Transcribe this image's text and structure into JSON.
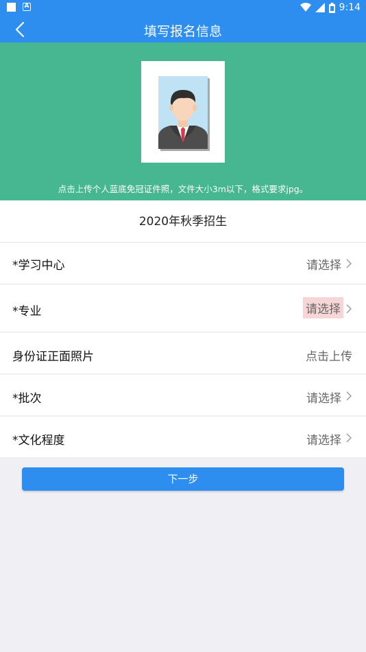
{
  "status_bar": {
    "time": "9:14"
  },
  "header": {
    "title": "填写报名信息"
  },
  "photo": {
    "hint": "点击上传个人蓝底免冠证件照，文件大小3m以下，格式要求jpg。"
  },
  "season": {
    "title": "2020年秋季招生"
  },
  "form": {
    "rows": [
      {
        "label": "*学习中心",
        "value": "请选择"
      },
      {
        "label": "*专业",
        "value": "请选择"
      },
      {
        "label": "身份证正面照片",
        "value": "点击上传"
      },
      {
        "label": "*批次",
        "value": "请选择"
      },
      {
        "label": "*文化程度",
        "value": "请选择"
      }
    ]
  },
  "actions": {
    "next_label": "下一步"
  },
  "colors": {
    "primary": "#2e8ef0",
    "photo_bg": "#46b790",
    "highlight": "#f7d6d8"
  }
}
